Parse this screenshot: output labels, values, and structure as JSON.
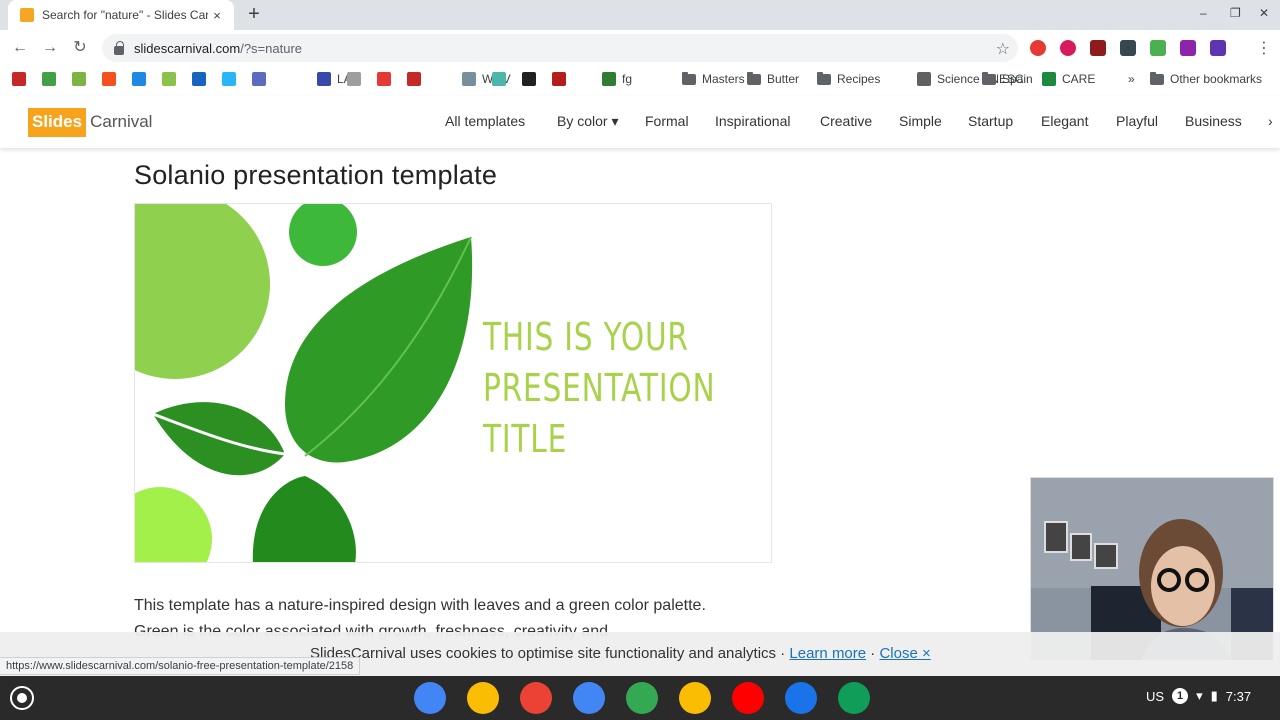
{
  "browser": {
    "tab_title": "Search for \"nature\" - Slides Carnival",
    "tab_close": "×",
    "new_tab": "+",
    "url_host": "slidescarnival.com",
    "url_path": "/?s=nature",
    "window_controls": {
      "minimize": "–",
      "restore": "❐",
      "close": "✕"
    }
  },
  "bookmarks": [
    {
      "label": "",
      "color": "#c62828"
    },
    {
      "label": "",
      "color": "#43a047"
    },
    {
      "label": "",
      "color": "#7cb342"
    },
    {
      "label": "",
      "color": "#f4511e"
    },
    {
      "label": "",
      "color": "#1e88e5"
    },
    {
      "label": "",
      "color": "#8bc34a"
    },
    {
      "label": "",
      "color": "#1565c0"
    },
    {
      "label": "",
      "color": "#29b6f6"
    },
    {
      "label": "",
      "color": "#5c6bc0"
    },
    {
      "label": "LAT",
      "color": "#3949ab"
    },
    {
      "label": "",
      "color": "#9e9e9e"
    },
    {
      "label": "",
      "color": "#e53935"
    },
    {
      "label": "",
      "color": "#c62828"
    },
    {
      "label": "WJIV",
      "color": "#78909c"
    },
    {
      "label": "",
      "color": "#4db6ac"
    },
    {
      "label": "",
      "color": "#212121"
    },
    {
      "label": "",
      "color": "#b71c1c"
    },
    {
      "label": "fg",
      "color": "#2e7d32"
    },
    {
      "label": "Masters",
      "folder": true
    },
    {
      "label": "Butter",
      "folder": true
    },
    {
      "label": "Recipes",
      "folder": true
    },
    {
      "label": "Science FNESC",
      "color": "#616161"
    },
    {
      "label": "Spain",
      "folder": true
    },
    {
      "label": "CARE",
      "color": "#1b8a3e"
    }
  ],
  "bookmarks_overflow": "»",
  "other_bookmarks": "Other bookmarks",
  "site": {
    "logo_slides": "Slides",
    "logo_carnival": "Carnival",
    "nav": [
      "All templates",
      "By color ▾",
      "Formal",
      "Inspirational",
      "Creative",
      "Simple",
      "Startup",
      "Elegant",
      "Playful",
      "Business"
    ],
    "nav_more": "›"
  },
  "page": {
    "title": "Solanio presentation template",
    "slide_text_line1": "THIS IS YOUR",
    "slide_text_line2": "PRESENTATION",
    "slide_text_line3": "TITLE",
    "description": "This template has a nature-inspired design with leaves and a green color palette. Green is the color associated with growth, freshness, creativity and"
  },
  "cookie": {
    "text": "SlidesCarnival uses cookies to optimise site functionality and analytics · ",
    "learn_more": "Learn more",
    "separator": " · ",
    "close": "Close ×"
  },
  "status_url": "https://www.slidescarnival.com/solanio-free-presentation-template/2158",
  "shelf": {
    "apps": [
      {
        "name": "chrome",
        "color": "#4285f4"
      },
      {
        "name": "keep",
        "color": "#fbbc04"
      },
      {
        "name": "gmail",
        "color": "#ea4335"
      },
      {
        "name": "docs",
        "color": "#4285f4"
      },
      {
        "name": "play-store",
        "color": "#34a853"
      },
      {
        "name": "photos",
        "color": "#fbbc04"
      },
      {
        "name": "youtube",
        "color": "#ff0000"
      },
      {
        "name": "files",
        "color": "#1a73e8"
      },
      {
        "name": "classroom",
        "color": "#0f9d58"
      }
    ],
    "locale": "US",
    "notifications": "1",
    "time": "7:37"
  },
  "colors": {
    "leaf_dark": "#2e8b23",
    "leaf_light": "#8fd14f",
    "slide_title": "#a8d24a",
    "logo_orange": "#f7a31c"
  }
}
